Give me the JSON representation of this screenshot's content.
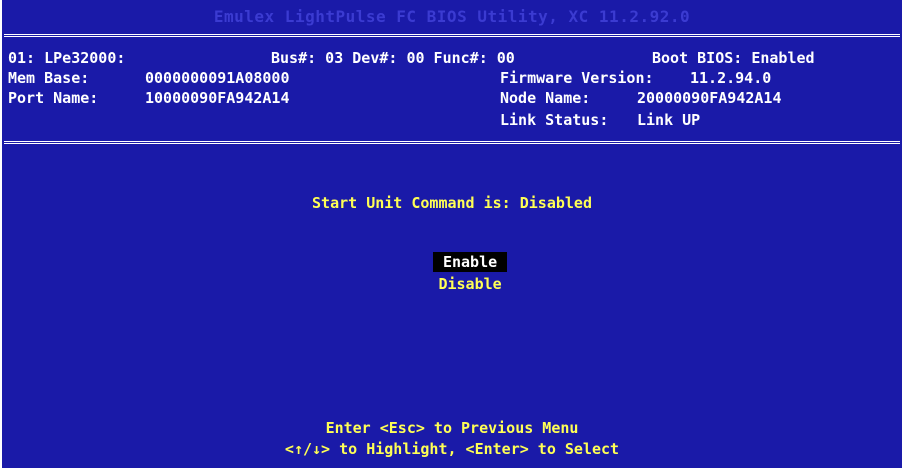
{
  "title": "Emulex LightPulse FC BIOS Utility, XC 11.2.92.0",
  "info": {
    "adapter": "01: LPe32000:",
    "bus_dev_func": "Bus#: 03 Dev#: 00 Func#: 00",
    "boot_bios": "Boot BIOS: Enabled",
    "mem_base_label": "Mem Base:",
    "mem_base_value": "0000000091A08000",
    "firmware_label": "Firmware Version:",
    "firmware_value": "11.2.94.0",
    "port_name_label": "Port Name:",
    "port_name_value": "10000090FA942A14",
    "node_name_label": "Node Name:",
    "node_name_value": "20000090FA942A14",
    "link_status_label": "Link Status:",
    "link_status_value": "Link UP"
  },
  "prompt": "Start Unit Command is: Disabled",
  "options": [
    {
      "label": "Enable",
      "selected": true
    },
    {
      "label": "Disable",
      "selected": false
    }
  ],
  "footer": {
    "line1": "Enter <Esc> to Previous Menu",
    "line2": "<↑/↓> to Highlight, <Enter> to Select"
  },
  "colors": {
    "background": "#1a1aa8",
    "text": "#ffffff",
    "highlight_text": "#ffff55",
    "selection_bg": "#000000",
    "title": "#3b3bd1"
  }
}
